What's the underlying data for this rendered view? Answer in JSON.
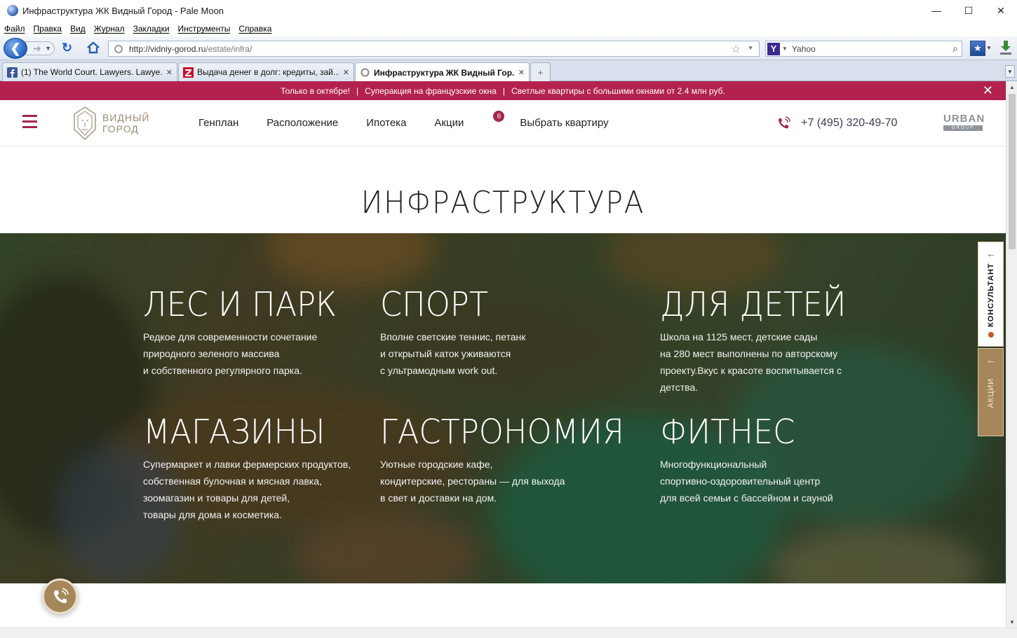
{
  "window": {
    "title": "Инфраструктура ЖК Видный Город - Pale Moon",
    "controls": {
      "minimize": "—",
      "maximize": "☐",
      "close": "✕"
    }
  },
  "menu": [
    "Файл",
    "Правка",
    "Вид",
    "Журнал",
    "Закладки",
    "Инструменты",
    "Справка"
  ],
  "address": {
    "host": "http://vidniy-gorod.ru",
    "path": "/estate/infra/"
  },
  "search": {
    "engine": "Y",
    "value": "Yahoo"
  },
  "tabs": [
    {
      "label": "(1) The World Court. Lawyers. Lawye...",
      "icon": "facebook-icon",
      "close": "✕"
    },
    {
      "label": "Выдача денег в долг: кредиты, зай...",
      "icon": "z-icon",
      "close": "✕"
    },
    {
      "label": "Инфраструктура ЖК Видный Гор...",
      "icon": "site-icon",
      "close": "✕",
      "active": true
    }
  ],
  "promo": {
    "items": [
      "Только в октябре!",
      "Суперакция на французские окна",
      "Светлые квартиры с большими окнами от 2.4 млн руб."
    ],
    "separator": "|",
    "close": "✕"
  },
  "site": {
    "logo_line1": "Видный",
    "logo_line2": "Город",
    "nav": [
      {
        "label": "Генплан"
      },
      {
        "label": "Расположение"
      },
      {
        "label": "Ипотека"
      },
      {
        "label": "Акции",
        "badge": "6"
      },
      {
        "label": "Выбрать квартиру"
      }
    ],
    "phone": "+7 (495) 320-49-70",
    "partner_line1": "URBAN",
    "partner_line2": "GROUP"
  },
  "page_title": "ИНФРАСТРУКТУРА",
  "features": [
    {
      "title": "ЛЕС И ПАРК",
      "lines": [
        "Редкое для современности сочетание",
        "природного зеленого массива",
        "и собственного регулярного парка."
      ]
    },
    {
      "title": "СПОРТ",
      "lines": [
        "Вполне светские теннис, петанк",
        "и открытый каток уживаются",
        "с ультрамодным work out."
      ]
    },
    {
      "title": "ДЛЯ ДЕТЕЙ",
      "lines": [
        "Школа на 1125 мест, детские сады",
        "на 280 мест выполнены по авторскому",
        "проекту.Вкус к красоте воспитывается с",
        "детства."
      ]
    },
    {
      "title": "МАГАЗИНЫ",
      "lines": [
        "Супермаркет и лавки фермерских продуктов,",
        "собственная булочная и мясная лавка,",
        "зоомагазин и товары для детей,",
        "товары для дома и косметика."
      ]
    },
    {
      "title": "ГАСТРОНОМИЯ",
      "lines": [
        "Уютные городские кафе,",
        "кондитерские, рестораны — для выхода",
        "в свет и доставки на дом."
      ]
    },
    {
      "title": "ФИТНЕС",
      "lines": [
        "Многофункциональный",
        "спортивно-оздоровительный центр",
        "для всей семьи с бассейном и сауной"
      ]
    }
  ],
  "side": {
    "consultant": "КОНСУЛЬТАНТ",
    "promo": "АКЦИИ"
  },
  "colors": {
    "brand": "#a3264b",
    "gold": "#a5875a",
    "promo_bar": "#b3224e"
  }
}
